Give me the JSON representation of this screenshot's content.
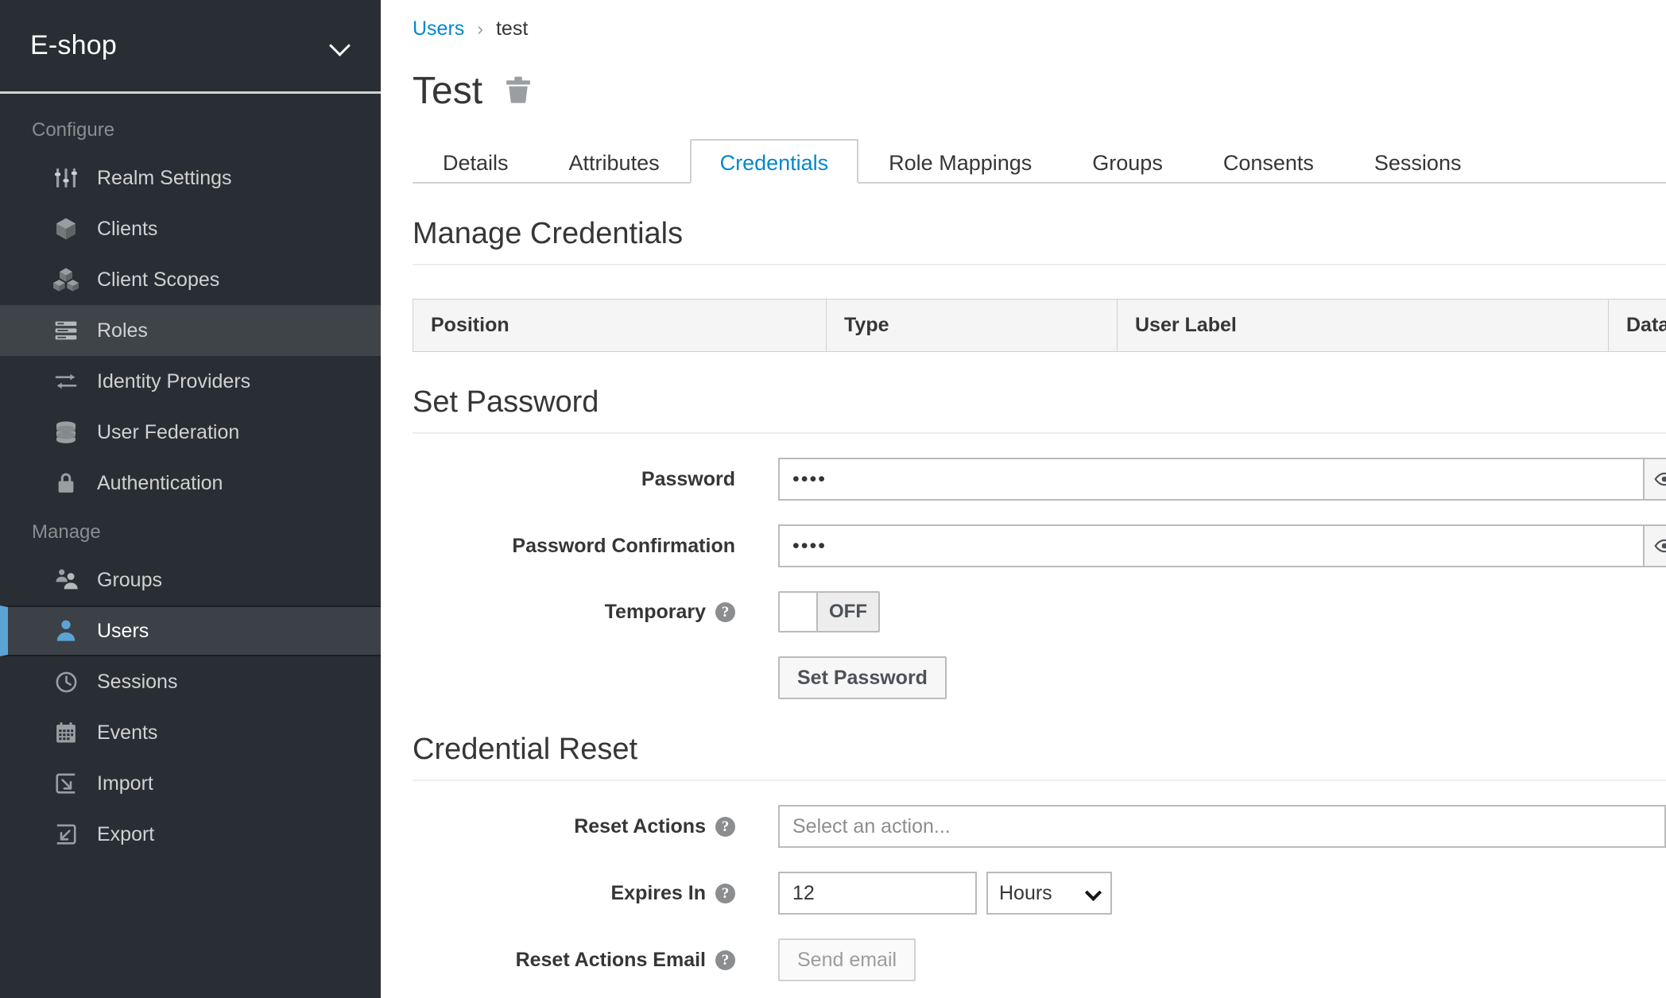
{
  "sidebar": {
    "realm": {
      "name": "E-shop",
      "chevron_icon": "chevron-down-icon"
    },
    "groups": [
      {
        "title": "Configure",
        "items": [
          {
            "label": "Realm Settings",
            "icon": "sliders-icon",
            "state": "normal"
          },
          {
            "label": "Clients",
            "icon": "cube-icon",
            "state": "normal"
          },
          {
            "label": "Client Scopes",
            "icon": "cubes-icon",
            "state": "normal"
          },
          {
            "label": "Roles",
            "icon": "list-icon",
            "state": "hovered"
          },
          {
            "label": "Identity Providers",
            "icon": "exchange-icon",
            "state": "normal"
          },
          {
            "label": "User Federation",
            "icon": "database-icon",
            "state": "normal"
          },
          {
            "label": "Authentication",
            "icon": "lock-icon",
            "state": "normal"
          }
        ]
      },
      {
        "title": "Manage",
        "items": [
          {
            "label": "Groups",
            "icon": "users-icon",
            "state": "normal"
          },
          {
            "label": "Users",
            "icon": "user-icon",
            "state": "active"
          },
          {
            "label": "Sessions",
            "icon": "clock-icon",
            "state": "normal"
          },
          {
            "label": "Events",
            "icon": "calendar-icon",
            "state": "normal"
          },
          {
            "label": "Import",
            "icon": "import-icon",
            "state": "normal"
          },
          {
            "label": "Export",
            "icon": "export-icon",
            "state": "normal"
          }
        ]
      }
    ]
  },
  "breadcrumb": {
    "parent": "Users",
    "separator": "›",
    "current": "test"
  },
  "page": {
    "title": "Test",
    "delete_icon": "trash-icon"
  },
  "tabs": [
    {
      "label": "Details",
      "active": false
    },
    {
      "label": "Attributes",
      "active": false
    },
    {
      "label": "Credentials",
      "active": true
    },
    {
      "label": "Role Mappings",
      "active": false
    },
    {
      "label": "Groups",
      "active": false
    },
    {
      "label": "Consents",
      "active": false
    },
    {
      "label": "Sessions",
      "active": false
    }
  ],
  "manage_credentials": {
    "heading": "Manage Credentials",
    "columns": [
      "Position",
      "Type",
      "User Label",
      "Data"
    ],
    "rows": []
  },
  "set_password": {
    "heading": "Set Password",
    "password": {
      "label": "Password",
      "value": "••••",
      "reveal_icon": "eye-icon"
    },
    "password_confirmation": {
      "label": "Password Confirmation",
      "value": "••••",
      "reveal_icon": "eye-icon"
    },
    "temporary": {
      "label": "Temporary",
      "help_icon": "help-circle-icon",
      "state": "OFF"
    },
    "submit_label": "Set Password"
  },
  "credential_reset": {
    "heading": "Credential Reset",
    "reset_actions": {
      "label": "Reset Actions",
      "help_icon": "help-circle-icon",
      "placeholder": "Select an action...",
      "value": ""
    },
    "expires_in": {
      "label": "Expires In",
      "help_icon": "help-circle-icon",
      "value": "12",
      "unit": "Hours",
      "unit_chevron_icon": "chevron-down-icon"
    },
    "reset_actions_email": {
      "label": "Reset Actions Email",
      "help_icon": "help-circle-icon",
      "button_label": "Send email",
      "disabled": true
    }
  },
  "colors": {
    "sidebar_bg": "#292e34",
    "sidebar_active_bg": "#3c4147",
    "sidebar_accent": "#5ba4d6",
    "link_blue": "#0088ce",
    "text": "#363636",
    "muted": "#8b8d8f",
    "border": "#d1d1d1"
  }
}
